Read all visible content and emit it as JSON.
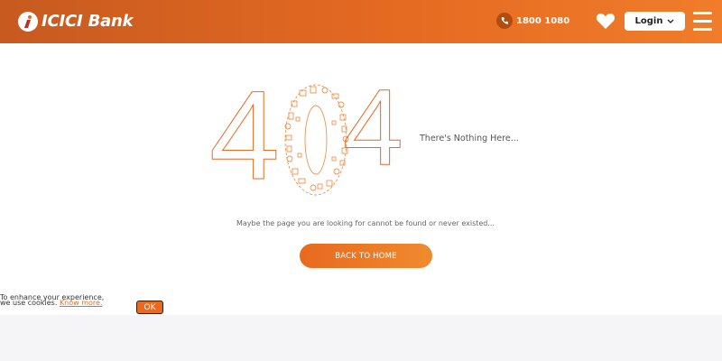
{
  "header": {
    "brand": "ICICI Bank",
    "phone_number": "1800 1080",
    "login_label": "Login",
    "icons": {
      "logo": "icici-logo-icon",
      "phone": "phone-icon",
      "favorites": "heart-icon",
      "login_dropdown": "chevron-down-icon",
      "menu": "hamburger-menu-icon"
    }
  },
  "error": {
    "code_left": "4",
    "code_right": "4",
    "tagline": "There's Nothing Here...",
    "message": "Maybe the page you are looking for cannot be found or never existed...",
    "back_button_label": "BACK TO HOME"
  },
  "cookie_banner": {
    "line1": "To enhance your experience,",
    "line2_prefix": "we use cookies.",
    "link_label": "Know more.",
    "ok_label": "OK"
  },
  "colors": {
    "brand_orange": "#e8691f",
    "header_dark": "#c75a1f",
    "footer_band": "#f5f5f7"
  }
}
